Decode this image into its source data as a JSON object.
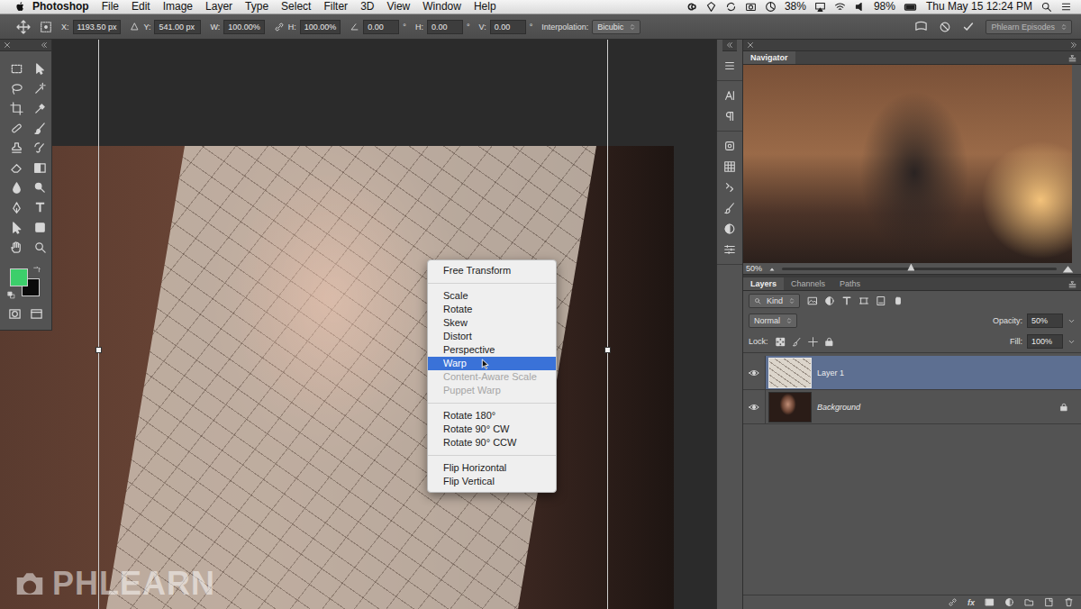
{
  "menubar": {
    "app": "Photoshop",
    "items": [
      "File",
      "Edit",
      "Image",
      "Layer",
      "Type",
      "Select",
      "Filter",
      "3D",
      "View",
      "Window",
      "Help"
    ],
    "status": [
      "38%",
      "98%"
    ],
    "clock": "Thu May 15 12:24 PM"
  },
  "options_bar": {
    "fields": [
      {
        "kind": "plain",
        "label": "X:",
        "value": "1193.50 px"
      },
      {
        "kind": "relative",
        "label": "Y:",
        "value": "541.00 px"
      },
      {
        "kind": "plain",
        "label": "W:",
        "value": "100.00%"
      },
      {
        "kind": "linked",
        "label": "H:",
        "value": "100.00%"
      },
      {
        "kind": "angle",
        "value": "0.00",
        "unit": "°"
      },
      {
        "kind": "plain",
        "label": "H:",
        "value": "0.00",
        "unit": "°"
      },
      {
        "kind": "plain",
        "label": "V:",
        "value": "0.00",
        "unit": "°"
      }
    ],
    "interpolation": {
      "label": "Interpolation:",
      "value": "Bicubic"
    },
    "workspace": "Phlearn Episodes"
  },
  "swatches": [
    {
      "name": "foreground",
      "color": "#3ccf6b"
    },
    {
      "name": "background",
      "color": "#0a0a0a"
    }
  ],
  "context_menu": {
    "groups": [
      [
        {
          "label": "Free Transform",
          "selected": false,
          "disabled": false
        }
      ],
      [
        {
          "label": "Scale",
          "selected": false,
          "disabled": false
        },
        {
          "label": "Rotate",
          "selected": false,
          "disabled": false
        },
        {
          "label": "Skew",
          "selected": false,
          "disabled": false
        },
        {
          "label": "Distort",
          "selected": false,
          "disabled": false
        },
        {
          "label": "Perspective",
          "selected": false,
          "disabled": false
        },
        {
          "label": "Warp",
          "selected": true,
          "disabled": false
        },
        {
          "label": "Content-Aware Scale",
          "selected": false,
          "disabled": true
        },
        {
          "label": "Puppet Warp",
          "selected": false,
          "disabled": true
        }
      ],
      [
        {
          "label": "Rotate 180°",
          "selected": false,
          "disabled": false
        },
        {
          "label": "Rotate 90° CW",
          "selected": false,
          "disabled": false
        },
        {
          "label": "Rotate 90° CCW",
          "selected": false,
          "disabled": false
        }
      ],
      [
        {
          "label": "Flip Horizontal",
          "selected": false,
          "disabled": false
        },
        {
          "label": "Flip Vertical",
          "selected": false,
          "disabled": false
        }
      ]
    ]
  },
  "navigator": {
    "title": "Navigator",
    "zoom": "50%",
    "level": 0.47
  },
  "layers_panel": {
    "tabs": [
      {
        "label": "Layers",
        "selected": true
      },
      {
        "label": "Channels",
        "selected": false
      },
      {
        "label": "Paths",
        "selected": false
      }
    ],
    "filter": "Kind",
    "blend_mode": "Normal",
    "opacity_label": "Opacity:",
    "opacity": "50%",
    "lock_label": "Lock:",
    "fill_label": "Fill:",
    "fill": "100%",
    "layers": [
      {
        "name": "Layer 1",
        "kind": "texture",
        "selected": true,
        "visible": true,
        "locked": false
      },
      {
        "name": "Background",
        "kind": "photo",
        "selected": false,
        "visible": true,
        "locked": true
      }
    ],
    "footer_label": "fx"
  },
  "watermark": "PHLEARN"
}
